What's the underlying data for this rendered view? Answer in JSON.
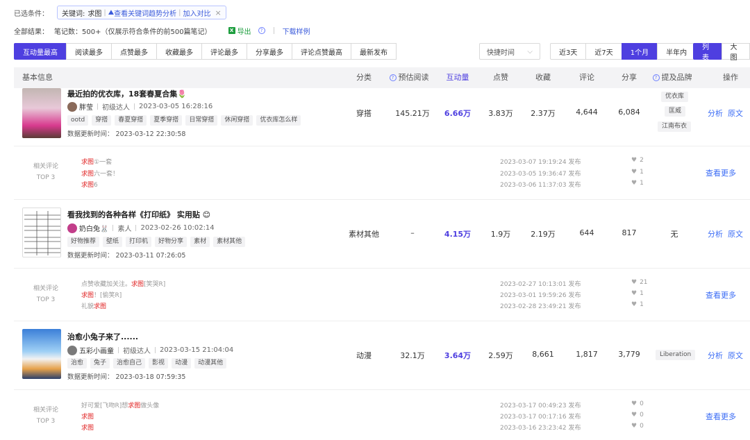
{
  "filters": {
    "label": "已选条件：",
    "keyword_prefix": "关键词:",
    "keyword": "求图",
    "trend_link": "查看关键词趋势分析",
    "compare_link": "加入对比",
    "close": "×"
  },
  "results": {
    "label": "全部结果：",
    "count": "笔记数：500+（仅展示符合条件的前500篇笔记）",
    "export": "导出",
    "download_sample": "下载样例"
  },
  "sort_tabs": [
    "互动量最高",
    "阅读最多",
    "点赞最多",
    "收藏最多",
    "评论最多",
    "分享最多",
    "评论点赞最高",
    "最新发布"
  ],
  "active_sort": "互动量最高",
  "time_select": {
    "label": "快捷时间",
    "chevron": "⌵"
  },
  "time_ranges": [
    "近3天",
    "近7天",
    "1个月",
    "半年内"
  ],
  "active_time": "1个月",
  "view_modes": [
    "列表",
    "大图"
  ],
  "active_view": "列表",
  "header": {
    "basic": "基本信息",
    "category": "分类",
    "est_read": "预估阅读",
    "interaction": "互动量",
    "likes": "点赞",
    "collects": "收藏",
    "comments": "评论",
    "shares": "分享",
    "brand": "提及品牌",
    "ops": "操作"
  },
  "notes": [
    {
      "title": "最近拍的优衣库，18套春夏合集🌷",
      "author": "胖莹",
      "level": "初级达人",
      "published": "2023-03-05 16:28:16",
      "tags": [
        "ootd",
        "穿搭",
        "春夏穿搭",
        "夏季穿搭",
        "日常穿搭",
        "休闲穿搭",
        "优衣库怎么样"
      ],
      "updated": "数据更新时间：   2023-03-12 22:30:58",
      "category": "穿搭",
      "est_read": "145.21万",
      "interaction": "6.66万",
      "likes": "3.83万",
      "collects": "2.37万",
      "comments": "4,644",
      "shares": "6,084",
      "brands": [
        "优衣库",
        "匡威",
        "江南布衣"
      ],
      "ops": {
        "analyze": "分析",
        "original": "原文"
      },
      "top_comments": {
        "label1": "相关评论",
        "label2": "TOP 3",
        "more": "查看更多",
        "items": [
          {
            "hl": "求图",
            "rest": "①一套",
            "hl_after": "",
            "pre": "",
            "date": "2023-03-07 19:19:24 发布",
            "likes": "2"
          },
          {
            "hl": "求图",
            "rest": "六一套！",
            "hl_after": "",
            "pre": "",
            "date": "2023-03-05 19:36:47 发布",
            "likes": "1"
          },
          {
            "hl": "求图",
            "rest": "6",
            "hl_after": "",
            "pre": "",
            "date": "2023-03-06 11:37:03 发布",
            "likes": "1"
          }
        ]
      }
    },
    {
      "title": "看我找到的各种各样《打印纸》 实用贴 😊",
      "author": "奶白兔🐰",
      "level": "素人",
      "published": "2023-02-26 10:02:14",
      "tags": [
        "好物推荐",
        "壁纸",
        "打印机",
        "好物分享",
        "素材",
        "素材其他"
      ],
      "updated": "数据更新时间：   2023-03-11 07:26:05",
      "category": "素材其他",
      "est_read": "–",
      "interaction": "4.15万",
      "likes": "1.9万",
      "collects": "2.19万",
      "comments": "644",
      "shares": "817",
      "brands_none": "无",
      "ops": {
        "analyze": "分析",
        "original": "原文"
      },
      "top_comments": {
        "label1": "相关评论",
        "label2": "TOP 3",
        "more": "查看更多",
        "items": [
          {
            "pre": "点赞收藏加关注。",
            "hl": "求图",
            "rest": "[笑哭R]",
            "date": "2023-02-27 10:13:01 发布",
            "likes": "21"
          },
          {
            "pre": "",
            "hl": "求图",
            "rest": "！[偷笑R]",
            "date": "2023-03-01 19:59:26 发布",
            "likes": "1"
          },
          {
            "pre": "礼貌",
            "hl": "求图",
            "rest": "",
            "date": "2023-02-28 23:49:21 发布",
            "likes": "1"
          }
        ]
      }
    },
    {
      "title": "治愈小兔子来了......",
      "author": "五彩小画童",
      "level": "初级达人",
      "published": "2023-03-15 21:04:04",
      "tags": [
        "治愈",
        "兔子",
        "治愈自己",
        "影视",
        "动漫",
        "动漫其他"
      ],
      "updated": "数据更新时间：   2023-03-18 07:59:35",
      "category": "动漫",
      "est_read": "32.1万",
      "interaction": "3.64万",
      "likes": "2.59万",
      "collects": "8,661",
      "comments": "1,817",
      "shares": "3,779",
      "brands": [
        "Liberation"
      ],
      "ops": {
        "analyze": "分析",
        "original": "原文"
      },
      "top_comments": {
        "label1": "相关评论",
        "label2": "TOP 3",
        "more": "查看更多",
        "items": [
          {
            "pre": "好可爱[飞吻R]想",
            "hl": "求图",
            "rest": "做头像",
            "date": "2023-03-17 00:49:23 发布",
            "likes": "0"
          },
          {
            "pre": "",
            "hl": "求图",
            "rest": "",
            "date": "2023-03-17 00:17:16 发布",
            "likes": "0"
          },
          {
            "pre": "",
            "hl": "求图",
            "rest": "",
            "date": "2023-03-16 23:23:42 发布",
            "likes": "0"
          }
        ]
      }
    }
  ],
  "colors": {
    "accent": "#4e3fe0",
    "link": "#3b6cf5",
    "highlight": "#e02020"
  }
}
